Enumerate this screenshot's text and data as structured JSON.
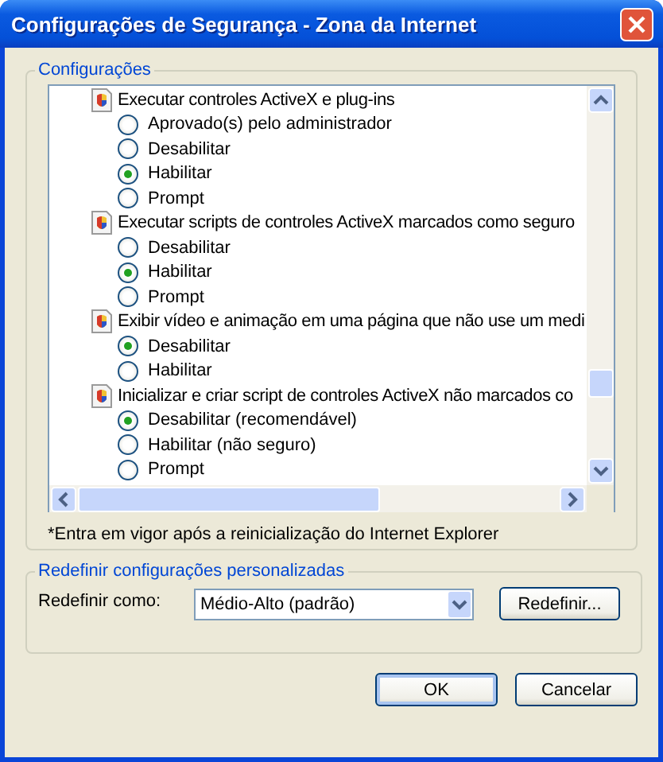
{
  "window": {
    "title": "Configurações de Segurança - Zona da Internet"
  },
  "settings_group": {
    "title": "Configurações",
    "items": [
      {
        "label": "Executar controles ActiveX e plug-ins",
        "options": [
          {
            "label": "Aprovado(s) pelo administrador",
            "selected": false
          },
          {
            "label": "Desabilitar",
            "selected": false
          },
          {
            "label": "Habilitar",
            "selected": true
          },
          {
            "label": "Prompt",
            "selected": false
          }
        ]
      },
      {
        "label": "Executar scripts de controles ActiveX marcados como seguro",
        "options": [
          {
            "label": "Desabilitar",
            "selected": false
          },
          {
            "label": "Habilitar",
            "selected": true
          },
          {
            "label": "Prompt",
            "selected": false
          }
        ]
      },
      {
        "label": "Exibir vídeo e animação em uma página que não use um medi",
        "options": [
          {
            "label": "Desabilitar",
            "selected": true
          },
          {
            "label": "Habilitar",
            "selected": false
          }
        ]
      },
      {
        "label": "Inicializar e criar script de controles ActiveX não marcados co",
        "options": [
          {
            "label": "Desabilitar (recomendável)",
            "selected": true
          },
          {
            "label": "Habilitar (não seguro)",
            "selected": false
          },
          {
            "label": "Prompt",
            "selected": false
          }
        ]
      }
    ]
  },
  "note": "*Entra em vigor após a reinicialização do Internet Explorer",
  "reset_group": {
    "title": "Redefinir configurações personalizadas",
    "label": "Redefinir como:",
    "select_value": "Médio-Alto (padrão)",
    "button": "Redefinir..."
  },
  "buttons": [
    {
      "label": "OK",
      "default": true
    },
    {
      "label": "Cancelar",
      "default": false
    }
  ]
}
